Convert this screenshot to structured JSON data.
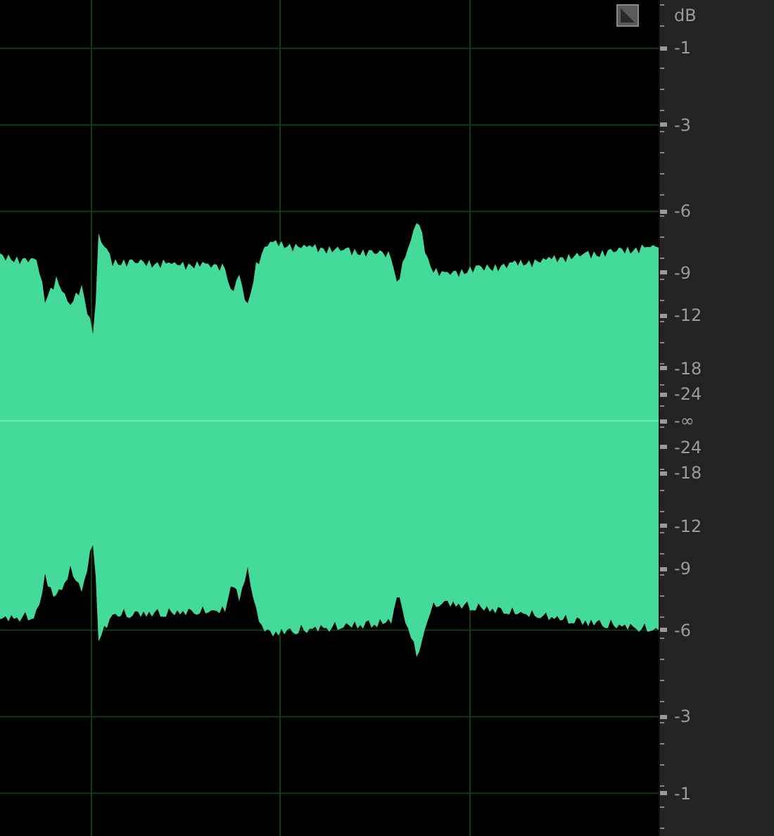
{
  "ruler": {
    "unit": "dB",
    "labels": [
      "-1",
      "-3",
      "-6",
      "-9",
      "-12",
      "-18",
      "-24",
      "-∞",
      "-24",
      "-18",
      "-12",
      "-9",
      "-6",
      "-3",
      "-1"
    ]
  }
}
